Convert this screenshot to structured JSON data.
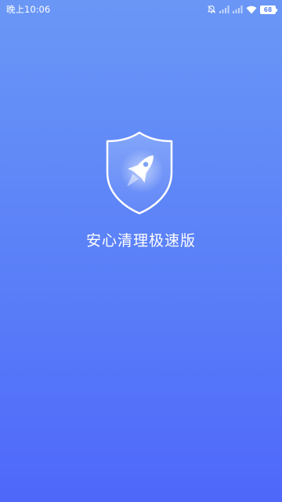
{
  "status_bar": {
    "time": "晚上10:06",
    "battery_level": "68",
    "icons": [
      "alarm-off-icon",
      "signal-icon",
      "signal-icon",
      "wifi-icon",
      "battery-icon"
    ]
  },
  "splash": {
    "logo_icon": "shield-rocket-icon",
    "app_name": "安心清理极速版"
  },
  "colors": {
    "background_top": "#6A97F6",
    "background_bottom": "#4E68FA",
    "text": "#ffffff"
  }
}
